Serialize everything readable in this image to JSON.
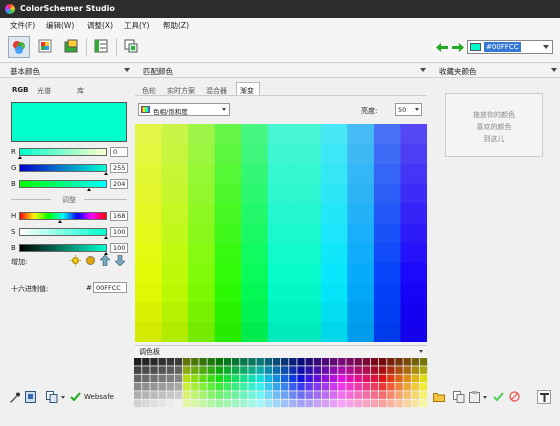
{
  "window": {
    "title": "ColorSchemer Studio"
  },
  "menu": [
    "文件(F)",
    "编辑(W)",
    "调整(X)",
    "工具(Y)",
    "帮助(Z)"
  ],
  "toolbar": {
    "hex": "#00FFCC"
  },
  "left": {
    "header": "基本颜色",
    "tabs": [
      "RGB",
      "光谱",
      "库"
    ],
    "swatch_color": "#00FFCC",
    "rgb": {
      "r_label": "R",
      "r": "0",
      "g_label": "G",
      "g": "255",
      "b_label": "B",
      "b": "204"
    },
    "adjust_label": "调整",
    "hsb": {
      "h_label": "H",
      "h": "168",
      "s_label": "S",
      "s": "100",
      "b_label": "B",
      "b": "100"
    },
    "add_label": "增加:",
    "hex_label": "十六进制值:",
    "hash": "#",
    "hex_value": "00FFCC",
    "websafe": "Websafe"
  },
  "middle": {
    "header": "匹配颜色",
    "tabs": [
      "色轮",
      "实时方案",
      "混合器",
      "渐变"
    ],
    "mode": "色相/饱和度",
    "brightness_label": "亮度:",
    "brightness": "50",
    "palette_header": "调色板"
  },
  "right": {
    "header": "收藏夹颜色",
    "drop_text": [
      "拖放你的颜色",
      "喜欢的颜色",
      "到这儿"
    ]
  }
}
